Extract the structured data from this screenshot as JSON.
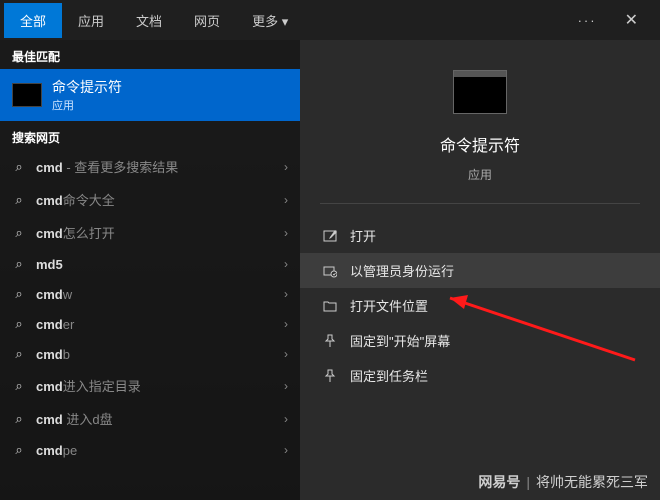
{
  "tabs": {
    "all": "全部",
    "app": "应用",
    "doc": "文档",
    "web": "网页",
    "more": "更多"
  },
  "left": {
    "bestMatchHeader": "最佳匹配",
    "bestMatchTitle": "命令提示符",
    "bestMatchSub": "应用",
    "searchWebHeader": "搜索网页",
    "items": [
      {
        "prefix": "cmd",
        "suffix": " - 查看更多搜索结果"
      },
      {
        "prefix": "cmd",
        "suffix": "命令大全"
      },
      {
        "prefix": "cmd",
        "suffix": "怎么打开"
      },
      {
        "prefix": "md5",
        "suffix": ""
      },
      {
        "prefix": "cmd",
        "suffix": "w"
      },
      {
        "prefix": "cmd",
        "suffix": "er"
      },
      {
        "prefix": "cmd",
        "suffix": "b"
      },
      {
        "prefix": "cmd",
        "suffix": "进入指定目录"
      },
      {
        "prefix": "cmd ",
        "suffix": "进入d盘"
      },
      {
        "prefix": "cmd",
        "suffix": "pe"
      }
    ]
  },
  "right": {
    "title": "命令提示符",
    "sub": "应用",
    "actions": {
      "open": "打开",
      "runAdmin": "以管理员身份运行",
      "openLocation": "打开文件位置",
      "pinStart": "固定到\"开始\"屏幕",
      "pinTaskbar": "固定到任务栏"
    }
  },
  "watermark": {
    "brand": "网易号",
    "author": "将帅无能累死三军"
  }
}
